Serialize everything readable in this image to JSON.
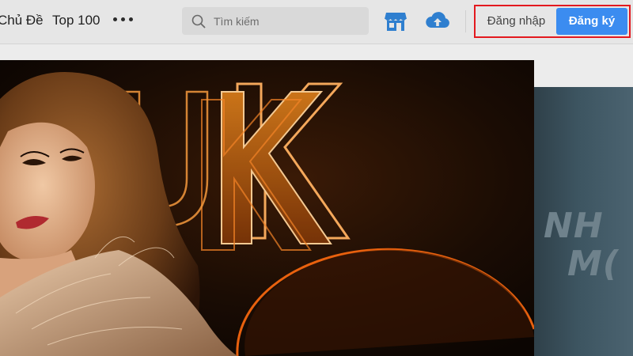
{
  "header": {
    "nav": {
      "topics_label": "Chủ Đề",
      "top100_label": "Top 100",
      "more_icon": "more-dots-icon"
    },
    "search": {
      "placeholder": "Tìm kiếm",
      "icon": "search-icon"
    },
    "actions": {
      "store_icon": "store-icon",
      "upload_icon": "cloud-upload-icon"
    },
    "auth": {
      "login_label": "Đăng nhập",
      "register_label": "Đăng ký",
      "highlight_color": "#e3191f",
      "register_color": "#3b8cf0"
    }
  },
  "banners": {
    "main": {
      "logo_text": "UK",
      "glow_color": "#ff7a1a"
    },
    "side": {
      "line1": "NH",
      "line2": "M("
    }
  },
  "colors": {
    "accent": "#3b8cf0",
    "icon_blue": "#2f7fcf"
  }
}
